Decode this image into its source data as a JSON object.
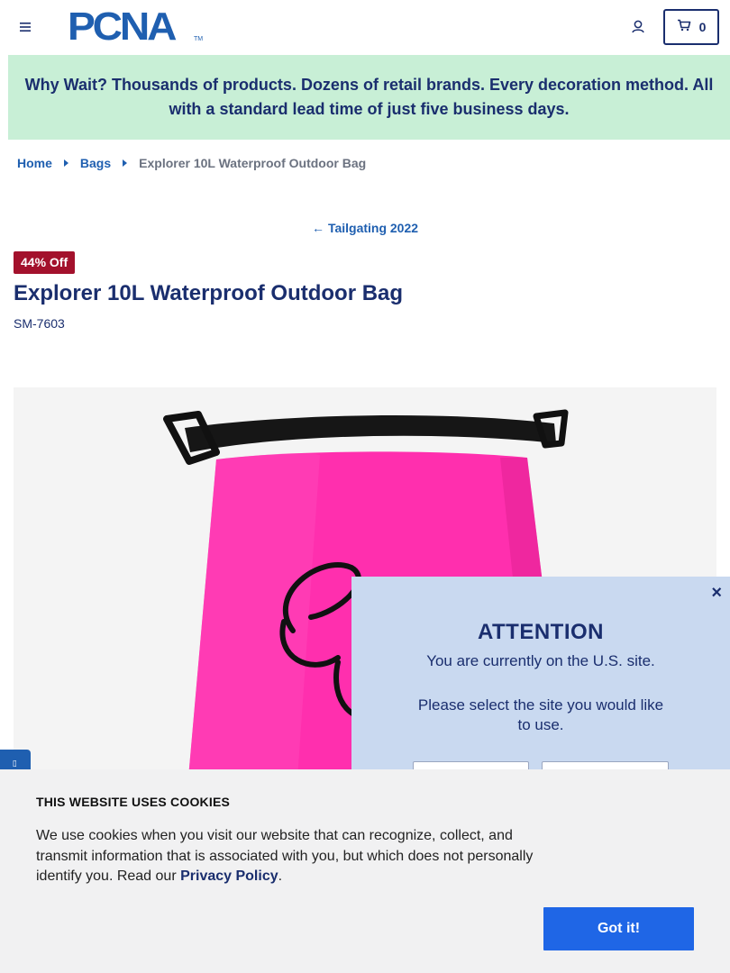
{
  "header": {
    "logo_text": "PCNA",
    "logo_tm": "TM",
    "cart_count": "0"
  },
  "banner": {
    "text": "Why Wait? Thousands of products. Dozens of retail brands. Every decoration method. All with a standard lead time of just five business days."
  },
  "breadcrumb": {
    "items": [
      "Home",
      "Bags"
    ],
    "current": "Explorer 10L Waterproof Outdoor Bag"
  },
  "collection_link": {
    "arrow": "←",
    "label": "Tailgating 2022"
  },
  "product": {
    "badge": "44% Off",
    "title": "Explorer 10L Waterproof Outdoor Bag",
    "sku": "SM-7603",
    "image_color": "#ff2fae"
  },
  "attention": {
    "close": "×",
    "title": "ATTENTION",
    "message": "You are currently on the U.S. site.",
    "prompt": "Please select the site you would like to use."
  },
  "cookie": {
    "title": "THIS WEBSITE USES COOKIES",
    "text_before": "We use cookies when you visit our website that can recognize, collect, and transmit information that is associated with you, but which does not personally identify you. Read our ",
    "link": "Privacy Policy",
    "text_after": ".",
    "button": "Got it!"
  },
  "colors": {
    "navy": "#1a2e6e",
    "blue": "#1f5fb0",
    "banner_bg": "#c8efd6",
    "badge_bg": "#a3112c",
    "modal_bg": "#c9d9f0",
    "cookie_btn": "#1f66e6"
  }
}
